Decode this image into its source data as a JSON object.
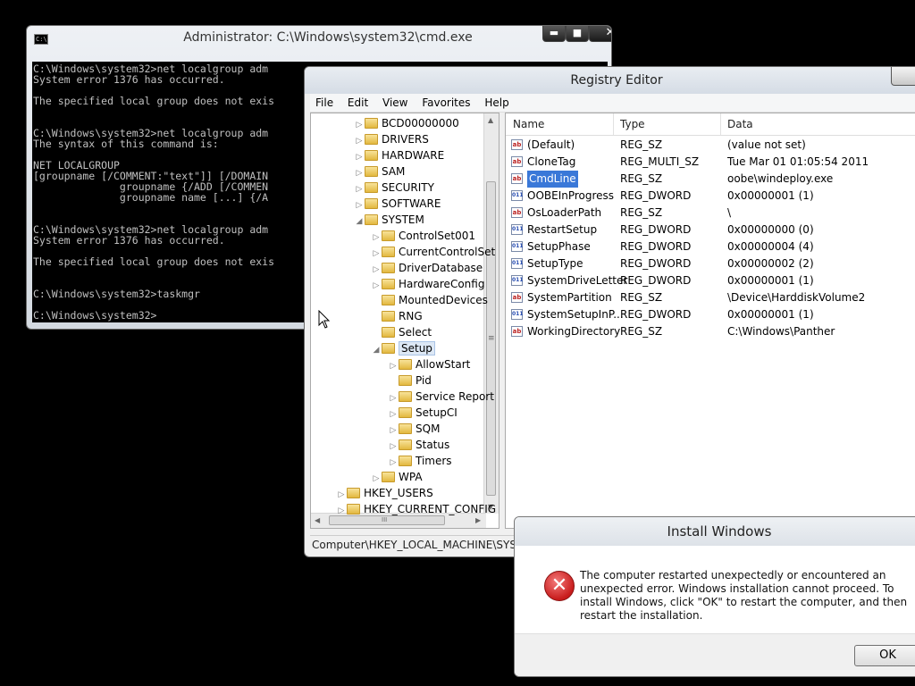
{
  "cmd": {
    "title": "Administrator: C:\\Windows\\system32\\cmd.exe",
    "icon_text": "C:\\",
    "buttons": {
      "minimize": "▬",
      "maximize": "■",
      "close": "✕"
    },
    "lines": [
      "C:\\Windows\\system32>net localgroup adm",
      "System error 1376 has occurred.",
      "",
      "The specified local group does not exis",
      "",
      "",
      "C:\\Windows\\system32>net localgroup adm",
      "The syntax of this command is:",
      "",
      "NET LOCALGROUP",
      "[groupname [/COMMENT:\"text\"]] [/DOMAIN",
      "              groupname {/ADD [/COMMEN",
      "              groupname name [...] {/A",
      "",
      "",
      "C:\\Windows\\system32>net localgroup adm",
      "System error 1376 has occurred.",
      "",
      "The specified local group does not exis",
      "",
      "",
      "C:\\Windows\\system32>taskmgr",
      "",
      "C:\\Windows\\system32>"
    ]
  },
  "regedit": {
    "title": "Registry Editor",
    "menu": [
      "File",
      "Edit",
      "View",
      "Favorites",
      "Help"
    ],
    "tree": [
      {
        "label": "BCD00000000",
        "level": 2,
        "arrow": "▷"
      },
      {
        "label": "DRIVERS",
        "level": 2,
        "arrow": "▷"
      },
      {
        "label": "HARDWARE",
        "level": 2,
        "arrow": "▷"
      },
      {
        "label": "SAM",
        "level": 2,
        "arrow": "▷"
      },
      {
        "label": "SECURITY",
        "level": 2,
        "arrow": "▷"
      },
      {
        "label": "SOFTWARE",
        "level": 2,
        "arrow": "▷"
      },
      {
        "label": "SYSTEM",
        "level": 2,
        "arrow": "◢"
      },
      {
        "label": "ControlSet001",
        "level": 3,
        "arrow": "▷"
      },
      {
        "label": "CurrentControlSet",
        "level": 3,
        "arrow": "▷"
      },
      {
        "label": "DriverDatabase",
        "level": 3,
        "arrow": "▷"
      },
      {
        "label": "HardwareConfig",
        "level": 3,
        "arrow": "▷"
      },
      {
        "label": "MountedDevices",
        "level": 3,
        "arrow": ""
      },
      {
        "label": "RNG",
        "level": 3,
        "arrow": ""
      },
      {
        "label": "Select",
        "level": 3,
        "arrow": ""
      },
      {
        "label": "Setup",
        "level": 3,
        "arrow": "◢",
        "selected": true
      },
      {
        "label": "AllowStart",
        "level": 4,
        "arrow": "▷"
      },
      {
        "label": "Pid",
        "level": 4,
        "arrow": ""
      },
      {
        "label": "Service Report",
        "level": 4,
        "arrow": "▷"
      },
      {
        "label": "SetupCI",
        "level": 4,
        "arrow": "▷"
      },
      {
        "label": "SQM",
        "level": 4,
        "arrow": "▷"
      },
      {
        "label": "Status",
        "level": 4,
        "arrow": "▷"
      },
      {
        "label": "Timers",
        "level": 4,
        "arrow": "▷"
      },
      {
        "label": "WPA",
        "level": 3,
        "arrow": "▷"
      },
      {
        "label": "HKEY_USERS",
        "level": 1,
        "arrow": "▷"
      },
      {
        "label": "HKEY_CURRENT_CONFIG",
        "level": 1,
        "arrow": "▷"
      }
    ],
    "scroll_glyphs": {
      "up": "▲",
      "down": "▼",
      "left": "◀",
      "right": "▶",
      "grip": "≡",
      "hgrip": "III"
    },
    "columns": [
      "Name",
      "Type",
      "Data"
    ],
    "values": [
      {
        "name": "(Default)",
        "type": "REG_SZ",
        "data": "(value not set)",
        "icon": "ab"
      },
      {
        "name": "CloneTag",
        "type": "REG_MULTI_SZ",
        "data": "Tue Mar 01 01:05:54 2011",
        "icon": "ab"
      },
      {
        "name": "CmdLine",
        "type": "REG_SZ",
        "data": "oobe\\windeploy.exe",
        "icon": "ab",
        "selected": true
      },
      {
        "name": "OOBEInProgress",
        "type": "REG_DWORD",
        "data": "0x00000001 (1)",
        "icon": "011"
      },
      {
        "name": "OsLoaderPath",
        "type": "REG_SZ",
        "data": "\\",
        "icon": "ab"
      },
      {
        "name": "RestartSetup",
        "type": "REG_DWORD",
        "data": "0x00000000 (0)",
        "icon": "011"
      },
      {
        "name": "SetupPhase",
        "type": "REG_DWORD",
        "data": "0x00000004 (4)",
        "icon": "011"
      },
      {
        "name": "SetupType",
        "type": "REG_DWORD",
        "data": "0x00000002 (2)",
        "icon": "011"
      },
      {
        "name": "SystemDriveLetter",
        "type": "REG_DWORD",
        "data": "0x00000001 (1)",
        "icon": "011"
      },
      {
        "name": "SystemPartition",
        "type": "REG_SZ",
        "data": "\\Device\\HarddiskVolume2",
        "icon": "ab"
      },
      {
        "name": "SystemSetupInP...",
        "type": "REG_DWORD",
        "data": "0x00000001 (1)",
        "icon": "011"
      },
      {
        "name": "WorkingDirectory",
        "type": "REG_SZ",
        "data": "C:\\Windows\\Panther",
        "icon": "ab"
      }
    ],
    "status": "Computer\\HKEY_LOCAL_MACHINE\\SYSTEM\\Setup"
  },
  "dialog": {
    "title": "Install Windows",
    "icon_glyph": "✕",
    "message": "The computer restarted unexpectedly or encountered an unexpected error. Windows installation cannot proceed. To install Windows, click \"OK\" to restart the computer, and then restart the installation.",
    "ok_label": "OK"
  }
}
